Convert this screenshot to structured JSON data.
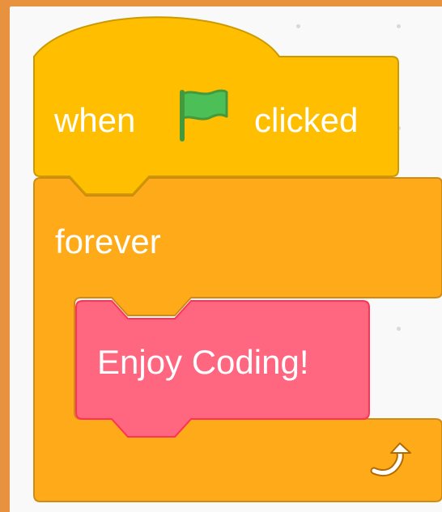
{
  "script": {
    "hat_block": {
      "word_before": "when",
      "icon": "green-flag-icon",
      "word_after": "clicked",
      "color": "#ffbf00",
      "border_color": "#cc9900"
    },
    "forever_block": {
      "label": "forever",
      "icon": "loop-arrow-icon",
      "color": "#ffab19",
      "border_color": "#cf8b17"
    },
    "inner_block": {
      "label": "Enjoy Coding!",
      "color": "#ff6680",
      "border_color": "#ff3355"
    }
  },
  "theme": {
    "frame_color": "#e8913f",
    "workspace_color": "#f9f9f9",
    "flag_color": "#4cbf56",
    "flag_outline": "#45993d"
  }
}
